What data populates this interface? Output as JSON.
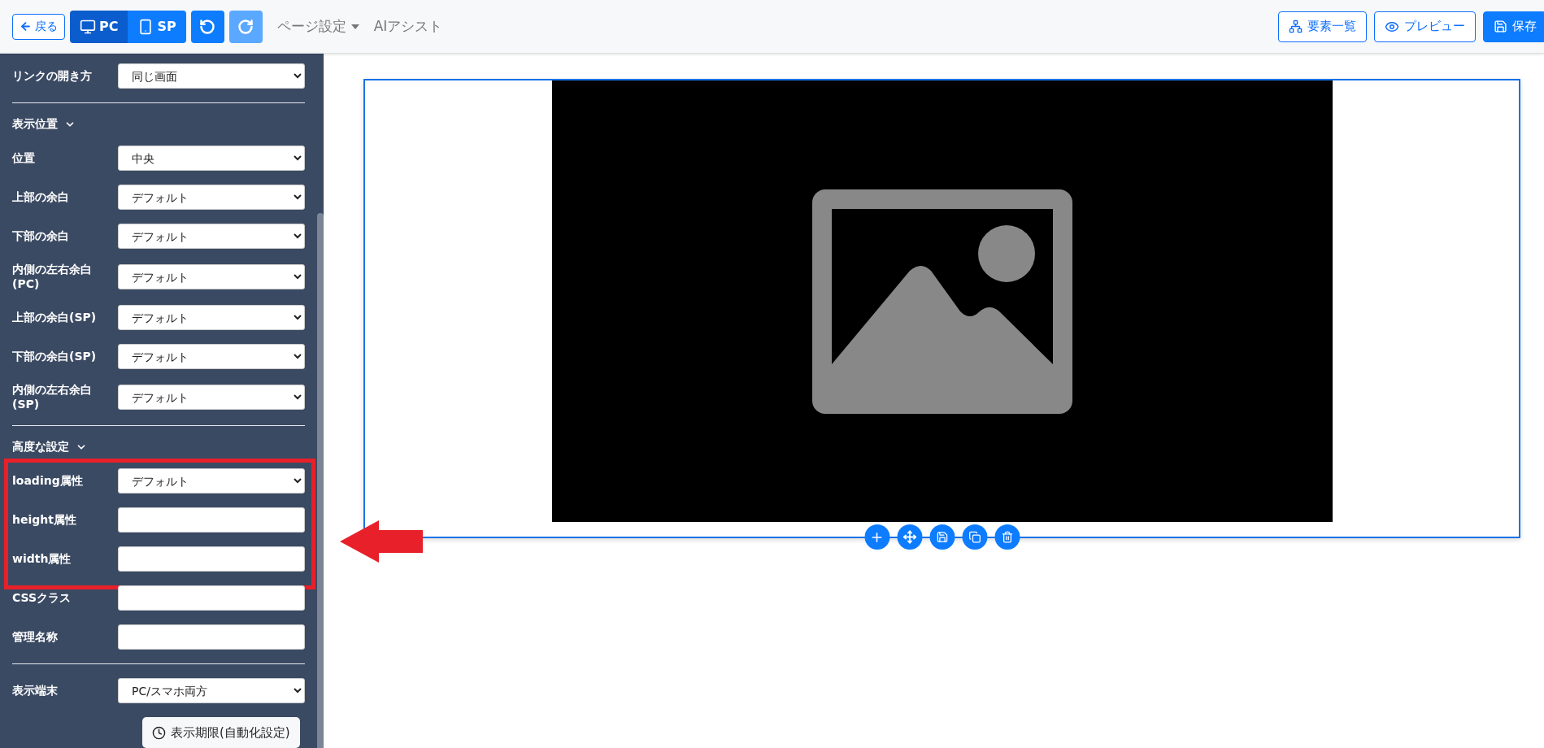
{
  "toolbar": {
    "back_button": "戻る",
    "device_tabs": [
      {
        "label": "PC",
        "kind": "desktop",
        "selected": true
      },
      {
        "label": "SP",
        "kind": "phone",
        "selected": false
      }
    ],
    "undo": {
      "disabled": false
    },
    "redo": {
      "disabled": true
    },
    "menus": [
      {
        "label": "ページ設定",
        "dropdown": true
      },
      {
        "label": "AIアシスト",
        "dropdown": false
      }
    ],
    "actions": [
      {
        "label": "要素一覧",
        "kind": "elements",
        "primary": false
      },
      {
        "label": "プレビュー",
        "kind": "preview",
        "primary": false
      },
      {
        "label": "保存",
        "kind": "save",
        "primary": true
      }
    ]
  },
  "sidebar": {
    "items": [
      {
        "kind": "select",
        "label": "リンクの開き方",
        "value": "同じ画面"
      },
      {
        "kind": "divider"
      },
      {
        "kind": "heading",
        "label": "表示位置",
        "expanded": true
      },
      {
        "kind": "select",
        "label": "位置",
        "value": "中央"
      },
      {
        "kind": "select",
        "label": "上部の余白",
        "value": "デフォルト"
      },
      {
        "kind": "select",
        "label": "下部の余白",
        "value": "デフォルト"
      },
      {
        "kind": "select",
        "label": "内側の左右余白(PC)",
        "value": "デフォルト"
      },
      {
        "kind": "select",
        "label": "上部の余白(SP)",
        "value": "デフォルト"
      },
      {
        "kind": "select",
        "label": "下部の余白(SP)",
        "value": "デフォルト"
      },
      {
        "kind": "select",
        "label": "内側の左右余白(SP)",
        "value": "デフォルト"
      },
      {
        "kind": "divider"
      },
      {
        "kind": "heading",
        "label": "高度な設定",
        "expanded": true
      },
      {
        "kind": "highlight",
        "children": [
          {
            "kind": "select",
            "label": "loading属性",
            "value": "デフォルト"
          },
          {
            "kind": "input",
            "label": "height属性"
          },
          {
            "kind": "input",
            "label": "width属性"
          }
        ]
      },
      {
        "kind": "input",
        "label": "CSSクラス"
      },
      {
        "kind": "input",
        "label": "管理名称"
      },
      {
        "kind": "divider"
      },
      {
        "kind": "select",
        "label": "表示端末",
        "value": "PC/スマホ両方"
      },
      {
        "kind": "button",
        "label": "表示期限(自動化設定)"
      }
    ]
  }
}
